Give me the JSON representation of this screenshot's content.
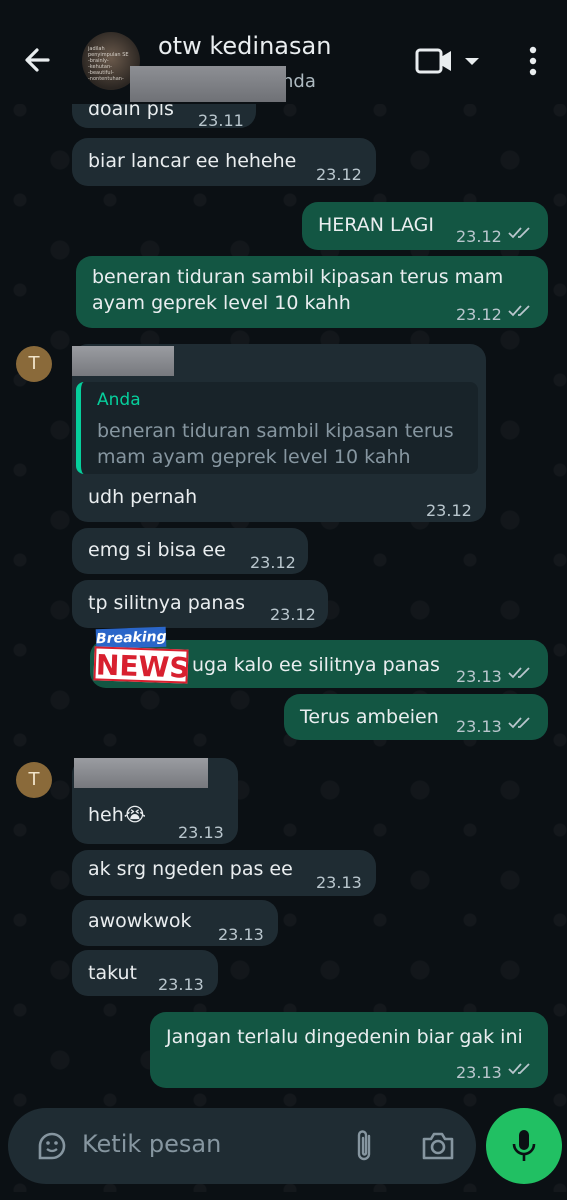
{
  "header": {
    "title": "otw kedinasan",
    "subtitle_visible": "nda",
    "avatar_caption_lines": [
      "jadilah penyimpulan SE",
      "-brainly-",
      "-kehutan-",
      "-beautiful-",
      "-nontentuhan-"
    ]
  },
  "messages": [
    {
      "id": "m1",
      "dir": "in",
      "text": "doain pls",
      "time": "23.11"
    },
    {
      "id": "m2",
      "dir": "in",
      "text": "biar lancar ee hehehe",
      "time": "23.12"
    },
    {
      "id": "m3",
      "dir": "out",
      "text": "HERAN LAGI",
      "time": "23.12"
    },
    {
      "id": "m4",
      "dir": "out",
      "text_line1": "beneran tiduran sambil kipasan terus mam",
      "text_line2": "ayam geprek level 10 kahh",
      "time": "23.12"
    },
    {
      "id": "m5",
      "dir": "in",
      "avatar_letter": "T",
      "quote_author": "Anda",
      "quote_line1": "beneran tiduran sambil kipasan terus",
      "quote_line2": "mam ayam geprek level 10 kahh",
      "text": "udh pernah",
      "time": "23.12"
    },
    {
      "id": "m6",
      "dir": "in",
      "text": "emg si bisa ee",
      "time": "23.12"
    },
    {
      "id": "m7",
      "dir": "in",
      "text": "tp silitnya panas",
      "time": "23.12"
    },
    {
      "id": "m8",
      "dir": "out",
      "sticker_top": "Breaking",
      "sticker_bottom": "NEWS",
      "text": "uga kalo ee silitnya panas",
      "time": "23.13"
    },
    {
      "id": "m9",
      "dir": "out",
      "text": "Terus ambeien",
      "time": "23.13"
    },
    {
      "id": "m10",
      "dir": "in",
      "avatar_letter": "T",
      "text": "heh",
      "emoji": "😭",
      "time": "23.13"
    },
    {
      "id": "m11",
      "dir": "in",
      "text": "ak srg ngeden pas ee",
      "time": "23.13"
    },
    {
      "id": "m12",
      "dir": "in",
      "text": "awowkwok",
      "time": "23.13"
    },
    {
      "id": "m13",
      "dir": "in",
      "text": "takut",
      "time": "23.13"
    },
    {
      "id": "m14",
      "dir": "out",
      "text": "Jangan terlalu dingedenin biar gak ini",
      "time": "23.13"
    }
  ],
  "input": {
    "placeholder": "Ketik pesan"
  },
  "icons": {
    "back": "arrow-left-icon",
    "video": "video-camera-icon",
    "dropdown": "caret-down-icon",
    "more": "more-vertical-icon",
    "emoji": "sticker-icon",
    "attach": "paperclip-icon",
    "camera": "camera-icon",
    "mic": "microphone-icon",
    "read": "double-check-icon"
  },
  "colors": {
    "background": "#0b1014",
    "incoming_bubble": "#1f2c33",
    "outgoing_bubble": "#135643",
    "accent": "#06cf9c",
    "mic_button": "#21c063"
  }
}
